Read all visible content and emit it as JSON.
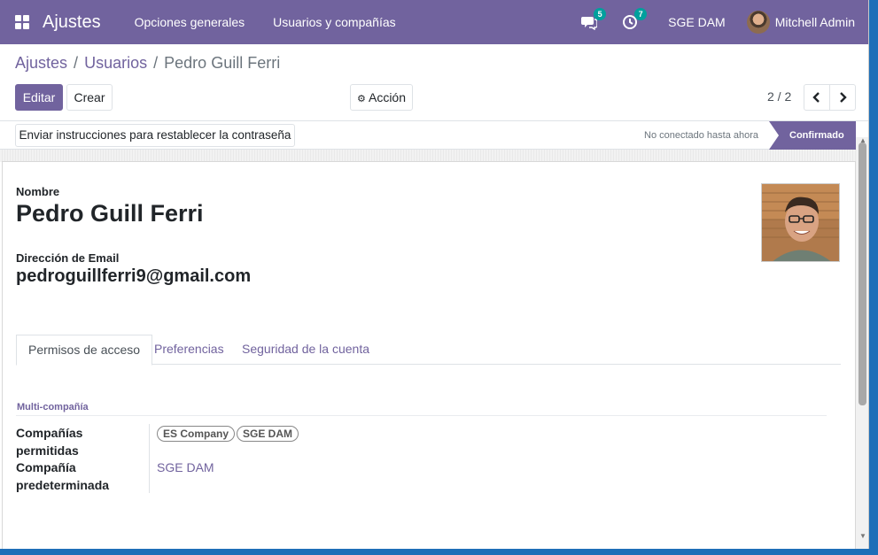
{
  "navbar": {
    "app_title": "Ajustes",
    "menu": [
      "Opciones generales",
      "Usuarios y compañías"
    ],
    "messages_count": "5",
    "activities_count": "7",
    "company": "SGE DAM",
    "user": "Mitchell Admin"
  },
  "breadcrumb": {
    "first": "Ajustes",
    "second": "Usuarios",
    "current": "Pedro Guill Ferri",
    "sep": "/"
  },
  "toolbar": {
    "edit_label": "Editar",
    "create_label": "Crear",
    "action_label": "Acción",
    "pager": "2 / 2"
  },
  "statusbar": {
    "reset_password_label": "Enviar instrucciones para restablecer la contraseña",
    "not_connected": "No conectado hasta ahora",
    "state": "Confirmado"
  },
  "form": {
    "name_label": "Nombre",
    "name_value": "Pedro Guill Ferri",
    "email_label": "Dirección de Email",
    "email_value": "pedroguillferri9@gmail.com"
  },
  "tabs": [
    "Permisos de acceso",
    "Preferencias",
    "Seguridad de la cuenta"
  ],
  "multi_company": {
    "title": "Multi-compañía",
    "allowed_label_1": "Compañías",
    "allowed_label_2": "permitidas",
    "allowed_tags": [
      "ES Company",
      "SGE DAM"
    ],
    "default_label_1": "Compañía",
    "default_label_2": "predeterminada",
    "default_value": "SGE DAM"
  },
  "colors": {
    "brand": "#71639e",
    "badge": "#00a09d"
  }
}
